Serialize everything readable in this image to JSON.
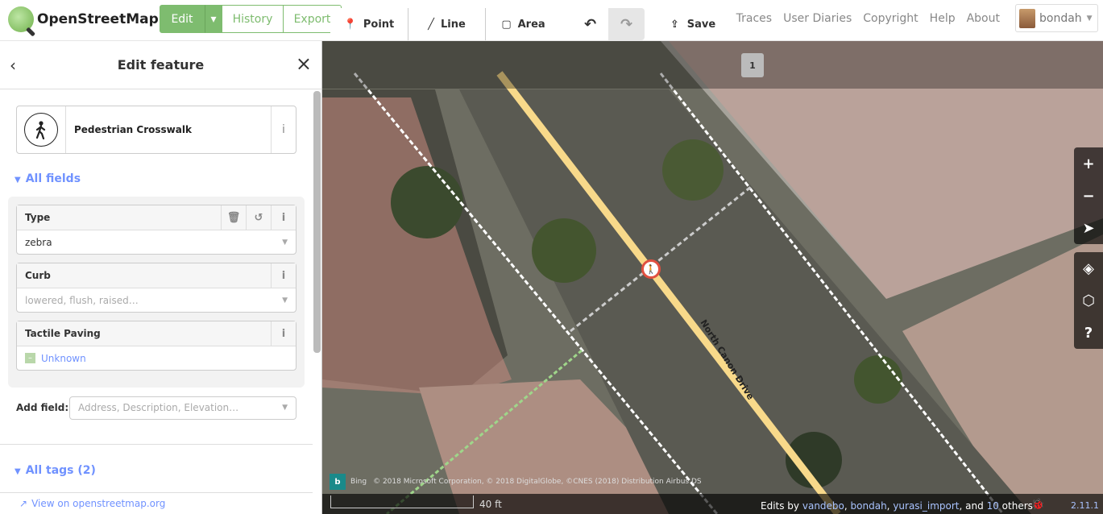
{
  "topbar": {
    "logo_text": "OpenStreetMap",
    "edit_label": "Edit",
    "history_label": "History",
    "export_label": "Export",
    "nav": [
      "GPS Traces",
      "User Diaries",
      "Copyright",
      "Help",
      "About"
    ],
    "username": "bondah"
  },
  "sidebar": {
    "title": "Edit feature",
    "preset_name": "Pedestrian Crosswalk",
    "all_fields_label": "All fields",
    "fields": [
      {
        "label": "Type",
        "value": "zebra"
      },
      {
        "label": "Curb",
        "placeholder": "lowered, flush, raised…"
      },
      {
        "label": "Tactile Paving",
        "value": "Unknown"
      }
    ],
    "add_field_label": "Add field:",
    "add_field_placeholder": "Address, Description, Elevation…",
    "all_tags_label": "All tags (2)",
    "view_osm_label": "View on openstreetmap.org"
  },
  "toolbar": {
    "point_label": "Point",
    "line_label": "Line",
    "area_label": "Area",
    "save_label": "Save",
    "save_count": "1"
  },
  "map": {
    "street_name": "North Canon Drive",
    "attribution": "© 2018 Microsoft Corporation, © 2018 DigitalGlobe, ©CNES (2018) Distribution Airbus DS",
    "bing_label": "Bing",
    "scale_label": "40 ft",
    "edits_prefix": "Edits by",
    "edit_users": [
      "vandebo",
      "bondah",
      "yurasi_import"
    ],
    "edits_and": ", and",
    "others_count": "10",
    "others_label": "others",
    "version": "2.11.1"
  },
  "icons": {
    "back": "chevron-left-icon",
    "close": "close-icon",
    "preset": "pedestrian-icon",
    "info": "info-icon",
    "trash": "trash-icon",
    "undo": "undo-icon"
  }
}
